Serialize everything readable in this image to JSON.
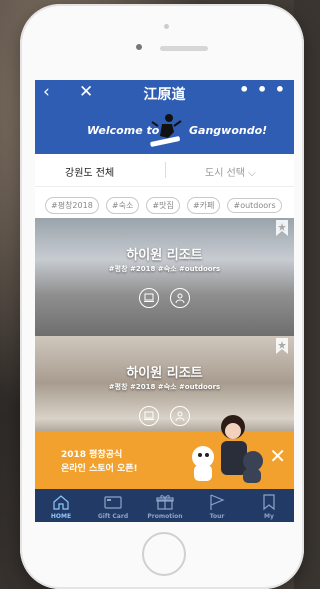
{
  "header": {
    "title": "江原道",
    "back_icon": "chevron-left-icon",
    "close_icon": "close-icon",
    "more_icon": "more-dots-icon",
    "more_label": "• • •"
  },
  "banner": {
    "welcome_left": "Welcome to",
    "welcome_right": "Gangwondo!"
  },
  "filter": {
    "region_all": "강원도 전체",
    "city_select": "도시 선택"
  },
  "tags": [
    "#평창2018",
    "#숙소",
    "#맛집",
    "#카페",
    "#outdoors"
  ],
  "cards": [
    {
      "name": "하이원 리조트",
      "hashtags": "#평창 #2018 #숙소 #outdoors"
    },
    {
      "name": "하이원 리조트",
      "hashtags": "#평창 #2018 #숙소 #outdoors"
    }
  ],
  "promo": {
    "line1": "2018 평창공식",
    "line2": "온라인 스토어 오픈!"
  },
  "tabbar": [
    {
      "label": "HOME",
      "icon": "home-icon",
      "active": true
    },
    {
      "label": "Gift Card",
      "icon": "gift-card-icon",
      "active": false
    },
    {
      "label": "Promotion",
      "icon": "gift-box-icon",
      "active": false
    },
    {
      "label": "Tour",
      "icon": "flag-icon",
      "active": false
    },
    {
      "label": "My",
      "icon": "bookmark-icon",
      "active": false
    }
  ],
  "colors": {
    "brand_blue": "#2f5db4",
    "tabbar": "#213a66",
    "promo": "#f2a12e"
  }
}
